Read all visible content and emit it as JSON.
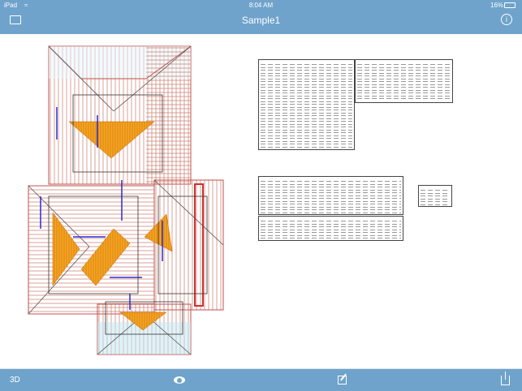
{
  "status_bar": {
    "device": "iPad",
    "time": "8:04 AM",
    "battery": "16%"
  },
  "nav_bar": {
    "title": "Sample1",
    "left_icon": "folder-icon",
    "right_icon": "info-icon"
  },
  "toolbar": {
    "mode_3d_label": "3D",
    "icons": [
      "eye-icon",
      "edit-icon",
      "share-icon"
    ]
  },
  "colors": {
    "bar": "#6fa3cb",
    "roof_fill": "#f5a623",
    "rafter": "#c0504d",
    "beam": "#2b2bd0"
  }
}
